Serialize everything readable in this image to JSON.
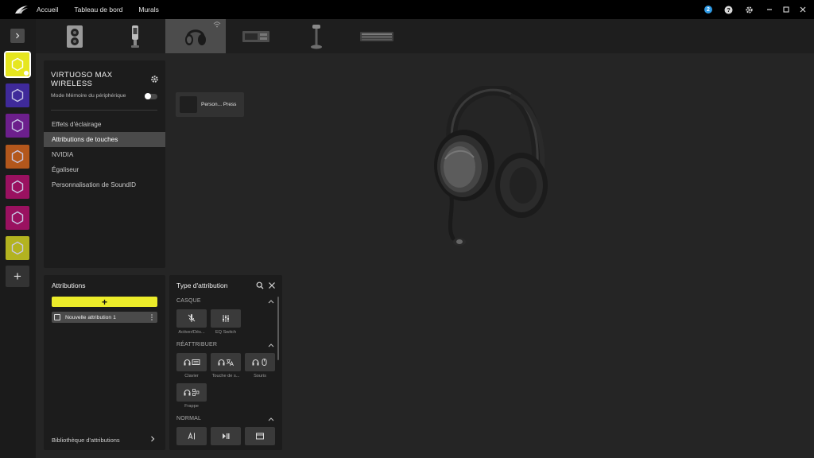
{
  "topbar": {
    "nav": [
      "Accueil",
      "Tableau de bord",
      "Murals"
    ],
    "notification_count": "2",
    "accent": "#2f9be6"
  },
  "profiles": {
    "colors": [
      "#e6e61f",
      "#3f2a9a",
      "#6c1f8c",
      "#b3571c",
      "#9a1160",
      "#9a1160",
      "#b3b320"
    ],
    "active_index": 0,
    "add_label": "+"
  },
  "devices": {
    "icons": [
      "tower-fan-device-icon",
      "microphone-device-icon",
      "headset-device-icon",
      "capture-card-device-icon",
      "headset-stand-device-icon",
      "keyboard-device-icon"
    ],
    "active_index": 2
  },
  "device_panel": {
    "title": "VIRTUOSO MAX WIRELESS",
    "memory_mode_label": "Mode Mémoire du périphérique",
    "memory_mode_enabled": false,
    "menu": [
      "Effets d'éclairage",
      "Attributions de touches",
      "NVIDIA",
      "Égaliseur",
      "Personnalisation de SoundID"
    ],
    "selected_menu_index": 1
  },
  "action_card": {
    "label": "Person... Press"
  },
  "assignments": {
    "title": "Attributions",
    "add_label": "+",
    "items": [
      "Nouvelle attribution 1"
    ],
    "library_label": "Bibliothèque d'attributions",
    "accent": "#ecec2a"
  },
  "assignment_type": {
    "title": "Type d'attribution",
    "sections": [
      {
        "title": "CASQUE",
        "tiles": [
          {
            "label": "Activer/Dés...",
            "icon": "mic-mute-icon"
          },
          {
            "label": "EQ Switch",
            "icon": "eq-sliders-icon"
          }
        ]
      },
      {
        "title": "RÉATTRIBUER",
        "tiles": [
          {
            "label": "Clavier",
            "icon": "headset-keyboard-icon"
          },
          {
            "label": "Touche de s...",
            "icon": "headset-translate-icon"
          },
          {
            "label": "Souris",
            "icon": "headset-mouse-icon"
          },
          {
            "label": "Frappe",
            "icon": "headset-keystroke-icon"
          }
        ]
      },
      {
        "title": "NORMAL",
        "tiles": [
          {
            "label": "",
            "icon": "text-cursor-icon"
          },
          {
            "label": "",
            "icon": "play-pause-icon"
          },
          {
            "label": "",
            "icon": "window-icon"
          }
        ]
      }
    ]
  }
}
